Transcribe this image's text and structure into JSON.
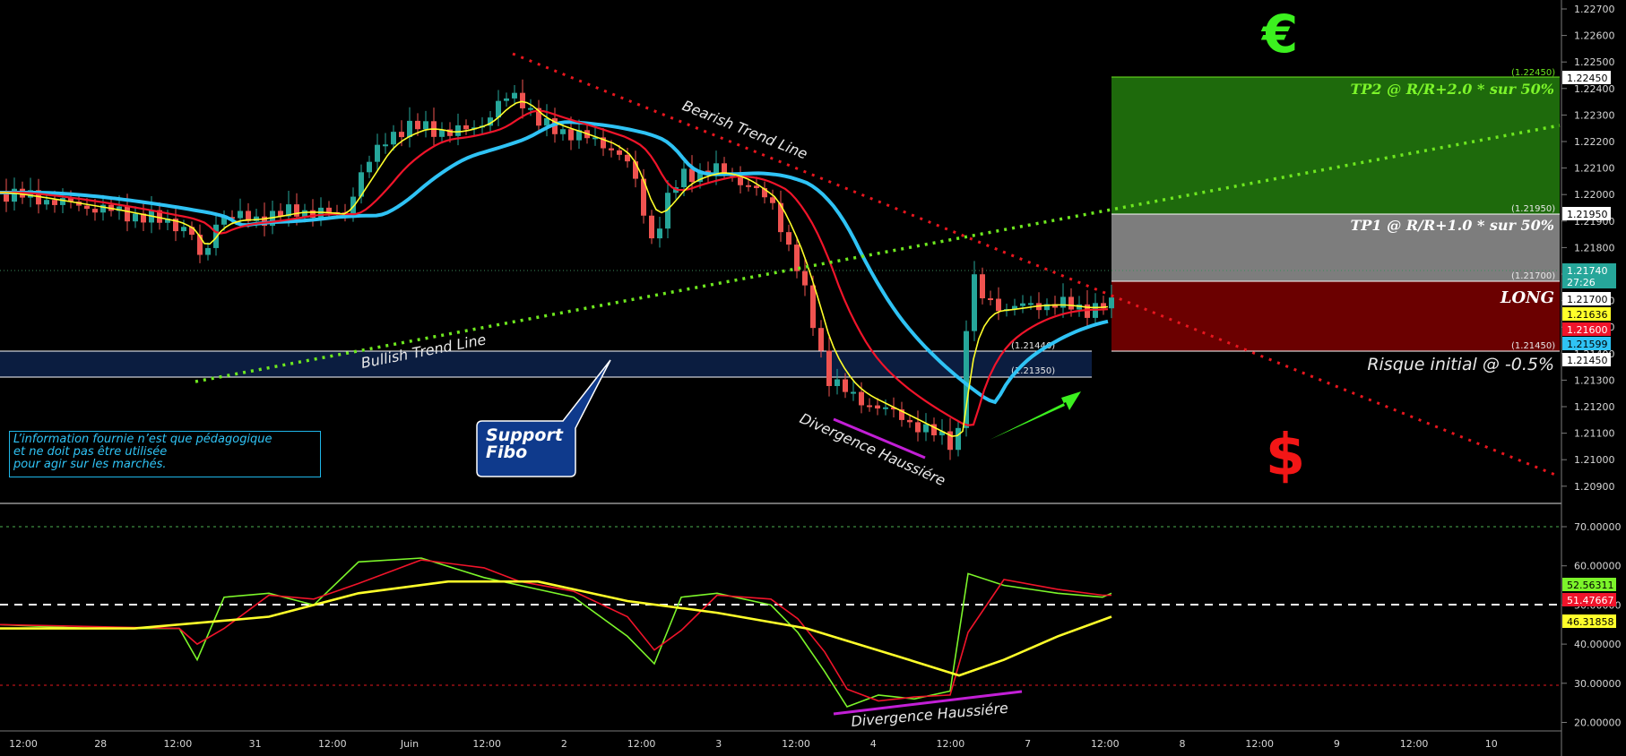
{
  "chart_data": [
    {
      "type": "candlestick",
      "title": "",
      "ylim": [
        1.2085,
        1.2275
      ],
      "y_ticks": [
        "1.22700",
        "1.22600",
        "1.22500",
        "1.22400",
        "1.22300",
        "1.22200",
        "1.22100",
        "1.22000",
        "1.21900",
        "1.21800",
        "1.21700",
        "1.21600",
        "1.21500",
        "1.21400",
        "1.21300",
        "1.21200",
        "1.21100",
        "1.21000",
        "1.20900"
      ],
      "x_ticks": [
        "12:00",
        "28",
        "12:00",
        "31",
        "12:00",
        "Juin",
        "12:00",
        "2",
        "12:00",
        "3",
        "12:00",
        "4",
        "12:00",
        "7",
        "12:00",
        "8",
        "12:00",
        "9",
        "12:00",
        "10"
      ],
      "series": [
        {
          "name": "",
          "color": "#2fc3f5",
          "role": "ema-slow"
        },
        {
          "name": "",
          "color": "#f0142a",
          "role": "ema-mid"
        },
        {
          "name": "",
          "color": "#ffff2a",
          "role": "ema-fast"
        }
      ],
      "price_labels": {
        "tp2": "1.22450",
        "tp1": "1.21950",
        "last": "1.21740",
        "countdown": "27:26",
        "entry": "1.21700",
        "ema_fast": "1.21636",
        "ema_mid": "1.21600",
        "ema_slow": "1.21599",
        "stop": "1.21450"
      },
      "levels": {
        "tp2": "(1.22450)",
        "tp1": "(1.21950)",
        "entry": "(1.21700)",
        "stop": "(1.21450)",
        "fibo_top": "(1.21446)",
        "fibo_bottom": "(1.21350)"
      },
      "zones": {
        "tp2": "TP2 @ R/R+2.0 * sur 50%",
        "tp1": "TP1 @ R/R+1.0 * sur 50%",
        "entry": "LONG",
        "risk": "Risque initial @ -0.5%"
      },
      "annotations": {
        "bearish": "Bearish Trend Line",
        "bullish": "Bullish Trend Line",
        "divergence": "Divergence Haussiére",
        "callout": [
          "Support",
          "Fibo"
        ],
        "euro": "€",
        "dollar": "$"
      }
    },
    {
      "type": "line",
      "title": "",
      "ylim": [
        17,
        74
      ],
      "y_ticks": [
        "70.00000",
        "60.00000",
        "50.00000",
        "40.00000",
        "30.00000",
        "20.00000"
      ],
      "levels": [
        70,
        49,
        30
      ],
      "series": [
        {
          "name": "",
          "color": "#7cf52a",
          "last": "52.56311"
        },
        {
          "name": "",
          "color": "#f0142a",
          "last": "51.47667"
        },
        {
          "name": "",
          "color": "#ffff2a",
          "last": "46.31858"
        }
      ],
      "annotations": {
        "divergence": "Divergence Haussiére"
      }
    }
  ],
  "disclaimer": [
    "L’information fournie n’est que pédagogique",
    "et ne doit pas être utilisée",
    "pour agir sur les marchés."
  ],
  "colors": {
    "background": "#000000",
    "tp2_zone": "#1e6a0c",
    "tp1_zone": "#7d7d7d",
    "risk_zone": "#6b0000",
    "fibo_band": "#0b1d40",
    "trend_bull": "#6ee81f",
    "trend_bear": "#e8161e",
    "divergence": "#c21fd6",
    "candle_up": "#26a69a",
    "candle_down": "#ef5350"
  }
}
